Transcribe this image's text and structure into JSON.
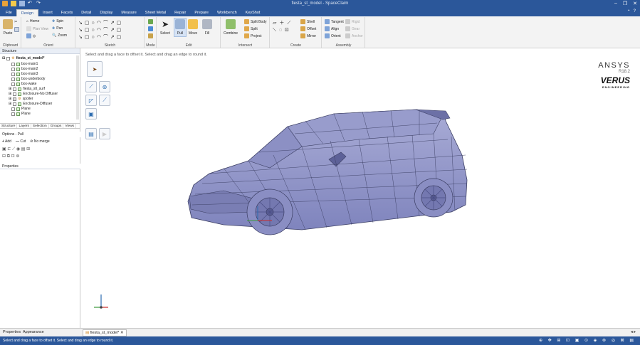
{
  "window": {
    "title": "fiesta_st_model - SpaceClaim"
  },
  "menu": {
    "tabs": [
      "File",
      "Design",
      "Insert",
      "Facets",
      "Detail",
      "Display",
      "Measure",
      "Sheet Metal",
      "Repair",
      "Prepare",
      "Workbench",
      "KeyShot"
    ],
    "active": "Design"
  },
  "ribbon": {
    "clipboard": {
      "name": "Clipboard",
      "paste": "Paste"
    },
    "orient": {
      "name": "Orient",
      "home": "Home",
      "plan_view": "Plan View",
      "spin": "Spin",
      "pan": "Pan",
      "zoom": "Zoom"
    },
    "sketch": {
      "name": "Sketch"
    },
    "mode": {
      "name": "Mode"
    },
    "edit": {
      "name": "Edit",
      "select": "Select",
      "pull": "Pull",
      "move": "Move",
      "fill": "Fill"
    },
    "intersect": {
      "name": "Intersect",
      "combine": "Combine",
      "split_body": "Split Body",
      "split": "Split",
      "project": "Project"
    },
    "create": {
      "name": "Create",
      "shell": "Shell",
      "offset": "Offset",
      "mirror": "Mirror"
    },
    "assembly": {
      "name": "Assembly",
      "tangent": "Tangent",
      "align": "Align",
      "orient": "Orient",
      "rigid": "Rigid",
      "gear": "Gear",
      "anchor": "Anchor"
    }
  },
  "structure": {
    "header": "Structure",
    "items": [
      "fiesta_st_model*",
      "box-main1",
      "box-main2",
      "box-main3",
      "box-underbody",
      "box-wake",
      "fiesta_stl_surf",
      "Enclosure-No Diffuser",
      "spoiler",
      "Enclosure-Diffuser",
      "Plane",
      "Plane"
    ],
    "tabs": [
      "Structure",
      "Layers",
      "Selection",
      "Groups",
      "Views"
    ]
  },
  "options": {
    "header": "Options - Pull",
    "add": "Add",
    "cut": "Cut",
    "no_merge": "No merge"
  },
  "properties": {
    "header": "Properties"
  },
  "bottom_tabs": {
    "properties": "Properties",
    "appearance": "Appearance",
    "doc_tab": "fiesta_st_model*"
  },
  "viewport": {
    "hint": "Select and drag a face to offset it. Select and drag an edge to round it."
  },
  "branding": {
    "ansys": "ANSYS",
    "version": "R18.2",
    "verus": "VERUS",
    "verus_sub": "ENGINEERING"
  },
  "status": {
    "text": "Select and drag a face to offset it. Select and drag an edge to round it."
  },
  "colors": {
    "chrome": "#2b579a",
    "car": "#8d92c8",
    "wire": "#3b3e63"
  }
}
